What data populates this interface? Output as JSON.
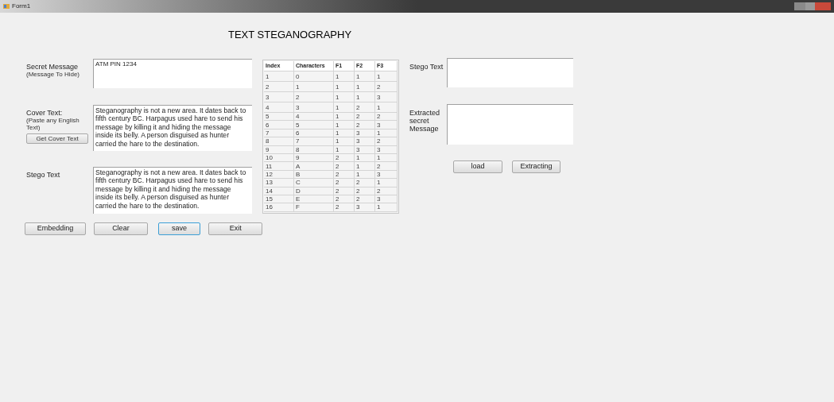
{
  "window": {
    "title": "Form1"
  },
  "heading": "TEXT STEGANOGRAPHY",
  "fields": [
    {
      "label": "Secret Message",
      "sublabel": "(Message To Hide)",
      "value": "ATM PIN 1234"
    },
    {
      "label": "Cover Text:",
      "sublabel": "(Paste any English Text)",
      "button": "Get Cover Text",
      "value": "Steganography is not a new area. It dates back to fifth century BC. Harpagus used hare to send his message by killing it and hiding the message inside its belly. A person disguised as hunter carried the hare to the destination."
    },
    {
      "label": "Stego Text",
      "value": "Steganography is not a new area. It dates back to fifth century BC. Harpagus used hare to send his message by killing it and hiding the message inside its belly. A person disguised as hunter carried the hare to the destination."
    }
  ],
  "buttons": [
    {
      "label": "Embedding",
      "focused": false
    },
    {
      "label": "Clear",
      "focused": false
    },
    {
      "label": "save",
      "focused": true
    },
    {
      "label": "Exit",
      "focused": false
    }
  ],
  "table": {
    "columns": [
      "Index",
      "Characters",
      "F1",
      "F2",
      "F3"
    ],
    "rows": [
      [
        "1",
        "0",
        "1",
        "1",
        "1"
      ],
      [
        "2",
        "1",
        "1",
        "1",
        "2"
      ],
      [
        "3",
        "2",
        "1",
        "1",
        "3"
      ],
      [
        "4",
        "3",
        "1",
        "2",
        "1"
      ],
      [
        "5",
        "4",
        "1",
        "2",
        "2"
      ],
      [
        "6",
        "5",
        "1",
        "2",
        "3"
      ],
      [
        "7",
        "6",
        "1",
        "3",
        "1"
      ],
      [
        "8",
        "7",
        "1",
        "3",
        "2"
      ],
      [
        "9",
        "8",
        "1",
        "3",
        "3"
      ],
      [
        "10",
        "9",
        "2",
        "1",
        "1"
      ],
      [
        "11",
        "A",
        "2",
        "1",
        "2"
      ],
      [
        "12",
        "B",
        "2",
        "1",
        "3"
      ],
      [
        "13",
        "C",
        "2",
        "2",
        "1"
      ],
      [
        "14",
        "D",
        "2",
        "2",
        "2"
      ],
      [
        "15",
        "E",
        "2",
        "2",
        "3"
      ],
      [
        "16",
        "F",
        "2",
        "3",
        "1"
      ]
    ]
  },
  "right_fields": [
    {
      "label": "Stego Text"
    },
    {
      "label": "Extracted secret Message"
    }
  ],
  "right_buttons": [
    {
      "label": "load",
      "focused": false
    },
    {
      "label": "Extracting",
      "focused": false
    }
  ]
}
